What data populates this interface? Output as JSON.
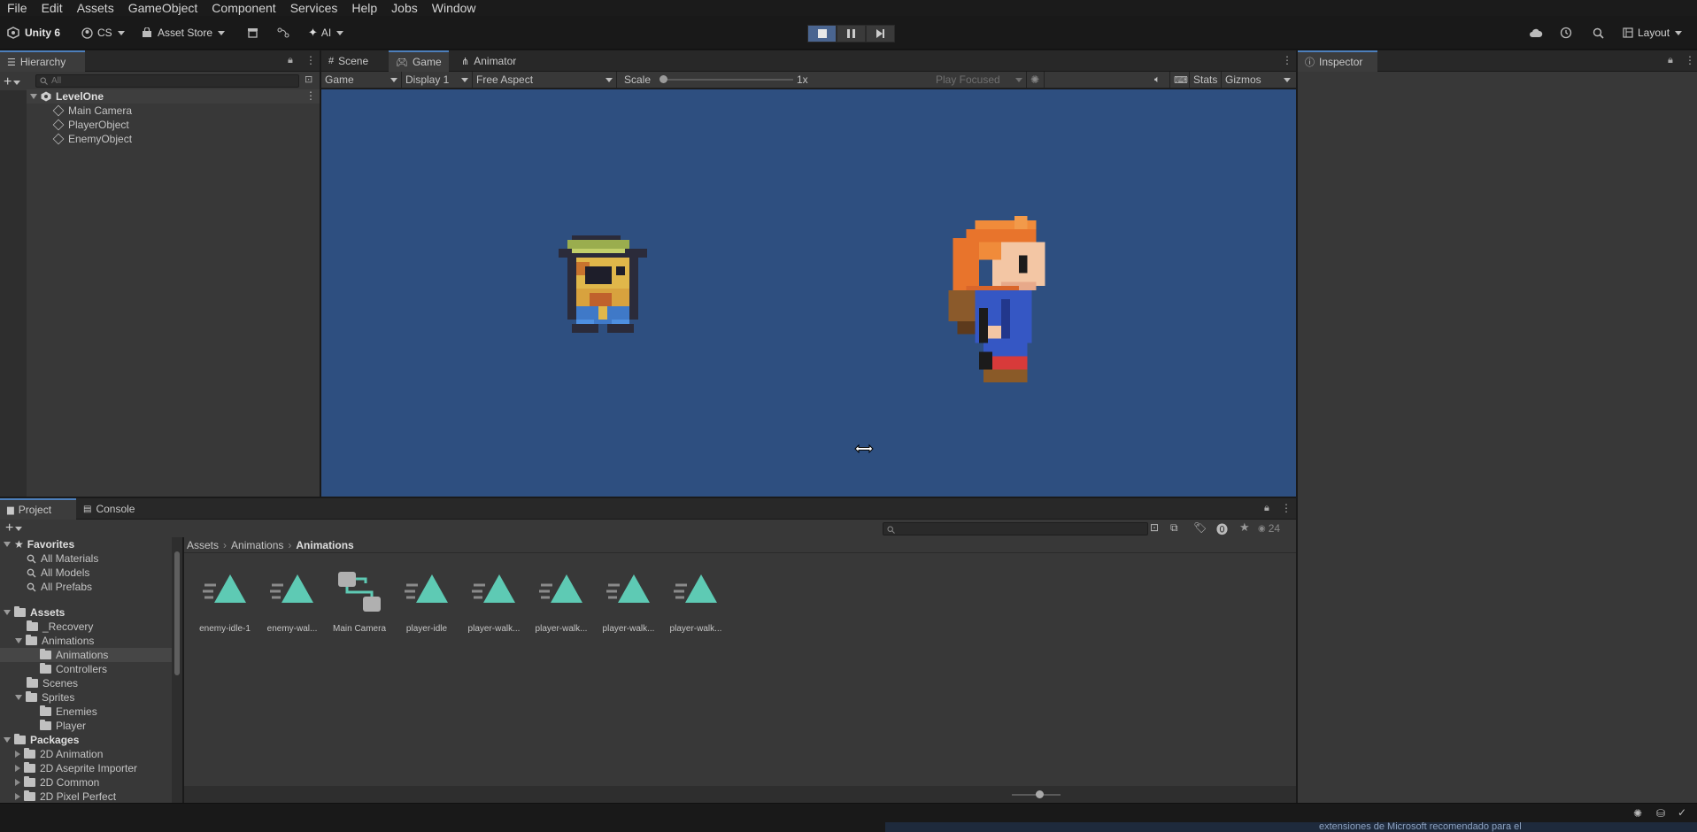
{
  "menu": [
    "File",
    "Edit",
    "Assets",
    "GameObject",
    "Component",
    "Services",
    "Help",
    "Jobs",
    "Window"
  ],
  "toolbar": {
    "unity_label": "Unity 6",
    "account_label": "CS",
    "asset_store_label": "Asset Store",
    "ai_label": "AI",
    "layout_label": "Layout"
  },
  "hierarchy": {
    "tab_label": "Hierarchy",
    "search_placeholder": "All",
    "scene": "LevelOne",
    "objects": [
      "Main Camera",
      "PlayerObject",
      "EnemyObject"
    ]
  },
  "center_tabs": [
    "Scene",
    "Game",
    "Animator"
  ],
  "game_bar": {
    "game_dropdown": "Game",
    "display": "Display 1",
    "aspect": "Free Aspect",
    "scale_label": "Scale",
    "scale_value": "1x",
    "play_focused": "Play Focused",
    "stats": "Stats",
    "gizmos": "Gizmos"
  },
  "inspector": {
    "tab_label": "Inspector"
  },
  "project": {
    "tabs": [
      "Project",
      "Console"
    ],
    "breadcrumb": [
      "Assets",
      "Animations",
      "Animations"
    ],
    "visible_count": "24",
    "tree": {
      "favorites": "Favorites",
      "favorite_items": [
        "All Materials",
        "All Models",
        "All Prefabs"
      ],
      "assets": "Assets",
      "asset_items": {
        "recovery": "_Recovery",
        "animations": "Animations",
        "animations_sub": "Animations",
        "controllers": "Controllers",
        "scenes": "Scenes",
        "sprites": "Sprites",
        "enemies": "Enemies",
        "player": "Player"
      },
      "packages": "Packages",
      "package_items": [
        "2D Animation",
        "2D Aseprite Importer",
        "2D Common",
        "2D Pixel Perfect"
      ]
    },
    "assets": [
      {
        "name": "enemy-idle-1",
        "kind": "animation-clip"
      },
      {
        "name": "enemy-wal...",
        "kind": "animation-clip"
      },
      {
        "name": "Main Camera",
        "kind": "animator-controller"
      },
      {
        "name": "player-idle",
        "kind": "animation-clip"
      },
      {
        "name": "player-walk...",
        "kind": "animation-clip"
      },
      {
        "name": "player-walk...",
        "kind": "animation-clip"
      },
      {
        "name": "player-walk...",
        "kind": "animation-clip"
      },
      {
        "name": "player-walk...",
        "kind": "animation-clip"
      }
    ]
  },
  "status_bar": {
    "overlay_text": "extensiones de Microsoft recomendado para el"
  },
  "colors": {
    "game_bg": "#2e4f80",
    "clip_teal": "#5ecab4",
    "play_active": "#4a6590",
    "selected_tab_accent": "#4d7fbb"
  }
}
